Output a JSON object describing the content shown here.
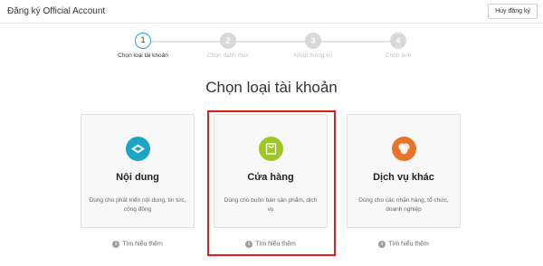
{
  "header": {
    "title": "Đăng ký Official Account",
    "cancel_label": "Hủy đăng ký"
  },
  "steps": [
    {
      "number": "1",
      "label": "Chọn loại tài khoản"
    },
    {
      "number": "2",
      "label": "Chọn danh mục"
    },
    {
      "number": "3",
      "label": "Nhập thông tin"
    },
    {
      "number": "4",
      "label": "Chọn ảnh"
    }
  ],
  "page_title": "Chọn loại tài khoản",
  "cards": [
    {
      "title": "Nội dung",
      "desc": "Dùng cho phát triển nội dung, tin tức, cộng đồng",
      "learn_more": "Tìm hiểu thêm",
      "icon": "content-icon",
      "color": "#1aa5c5"
    },
    {
      "title": "Cửa hàng",
      "desc": "Dùng cho buôn bán sản phẩm, dịch vụ",
      "learn_more": "Tìm hiểu thêm",
      "icon": "shopping-bag-icon",
      "color": "#9dc81f"
    },
    {
      "title": "Dịch vụ khác",
      "desc": "Dùng cho các nhãn hàng, tổ chức, doanh nghiệp",
      "learn_more": "Tìm hiểu thêm",
      "icon": "circles-icon",
      "color": "#e8732a"
    }
  ],
  "colors": {
    "accent": "#1f9fe3",
    "highlight": "#e01d1d"
  }
}
